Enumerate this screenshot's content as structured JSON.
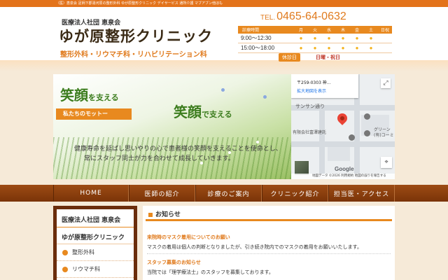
{
  "top_strip": {
    "text": "（医）恵泉会 足柄下郡湯河原の整形外科 ゆが原整形クリニック デイサービス 通所介護 マブアブン他ほも"
  },
  "header": {
    "org": "医療法人社団 恵泉会",
    "clinic_name": "ゆが原整形クリニック",
    "departments": "整形外科・リウマチ科・リハビリテーション科",
    "tel_prefix": "TEL.",
    "tel": "0465-64-0632"
  },
  "hours": {
    "label": "診療時間",
    "days": [
      "月",
      "火",
      "水",
      "木",
      "金",
      "土",
      "日祝"
    ],
    "rows": [
      {
        "time": "9:00〜12:30",
        "marks": [
          "●",
          "●",
          "●",
          "●",
          "●",
          "●",
          ""
        ]
      },
      {
        "time": "15:00〜18:00",
        "marks": [
          "●",
          "●",
          "●",
          "●",
          "●",
          "●",
          ""
        ]
      }
    ],
    "holiday_label": "休診日",
    "holiday_value": "日曜・祝日",
    "mark_color": "#f4b21d"
  },
  "hero": {
    "slogan1_a": "笑顔",
    "slogan1_b": "を支える",
    "slogan2_a": "笑顔",
    "slogan2_b": "で支える",
    "motto": "私たちのモットー",
    "mission_line1": "健康寿命を延ばし思いやりの心で患者様の笑顔を支えることを使命とし、",
    "mission_line2": "常にスタッフ同士が力を合わせて成長していきます。"
  },
  "map": {
    "address": "〒259-0303 神…",
    "enlarge_link": "拡大地図を表示",
    "expand_icon": "⤢",
    "street_label": "サンサン通り",
    "poi_1": "有限会社富澤建託",
    "poi_2": "グリーン",
    "poi_3": "(有)コーミ",
    "google_logo": "Google",
    "compass_icon": "⌖",
    "footer": "地図データ ©2026   利用規約   地図の誤りを報告する"
  },
  "nav": {
    "items": [
      "HOME",
      "医師の紹介",
      "診療のご案内",
      "クリニック紹介",
      "担当医・アクセス"
    ]
  },
  "sidebar": {
    "org": "医療法人社団 恵泉会",
    "clinic": "ゆが原整形クリニック",
    "items": [
      "整形外科",
      "リウマチ科"
    ]
  },
  "notices": {
    "heading": "お知らせ",
    "items": [
      {
        "title": "来院時のマスク着用についてのお願い",
        "body": "マスクの着用は個人の判断となりましたが、引き続き院内でのマスクの着用をお願いいたします。"
      },
      {
        "title": "スタッフ募集のお知らせ",
        "body": "当院では「理学療法士」のスタッフを募集しております。"
      }
    ]
  },
  "colors": {
    "accent": "#e8891f",
    "nav_bg": "#8a3f0e",
    "slogan": "#3c7d1e",
    "page_bg": "#f6ead8"
  }
}
